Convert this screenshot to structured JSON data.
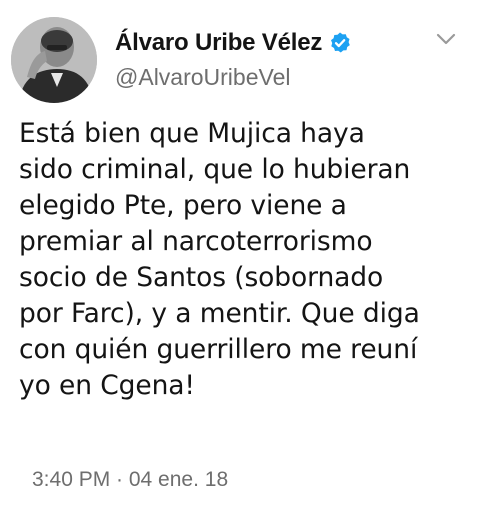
{
  "author": {
    "display_name": "Álvaro Uribe Vélez",
    "handle": "@AlvaroUribeVel",
    "verified": true,
    "avatar_icon": "profile-photo"
  },
  "menu": {
    "icon": "chevron-down-icon"
  },
  "tweet": {
    "lines": [
      "Está bien que Mujica haya",
      "sido criminal, que lo hubieran",
      "elegido Pte, pero viene a",
      "premiar al narcoterrorismo",
      "socio de Santos (sobornado",
      "por Farc), y a mentir. Que diga",
      "con quién guerrillero me reuní",
      "yo en Cgena!"
    ],
    "timestamp": "3:40 PM · 04 ene. 18"
  },
  "colors": {
    "text": "#141414",
    "secondary": "#6e6e6e",
    "verified_badge": "#1da1f2"
  }
}
